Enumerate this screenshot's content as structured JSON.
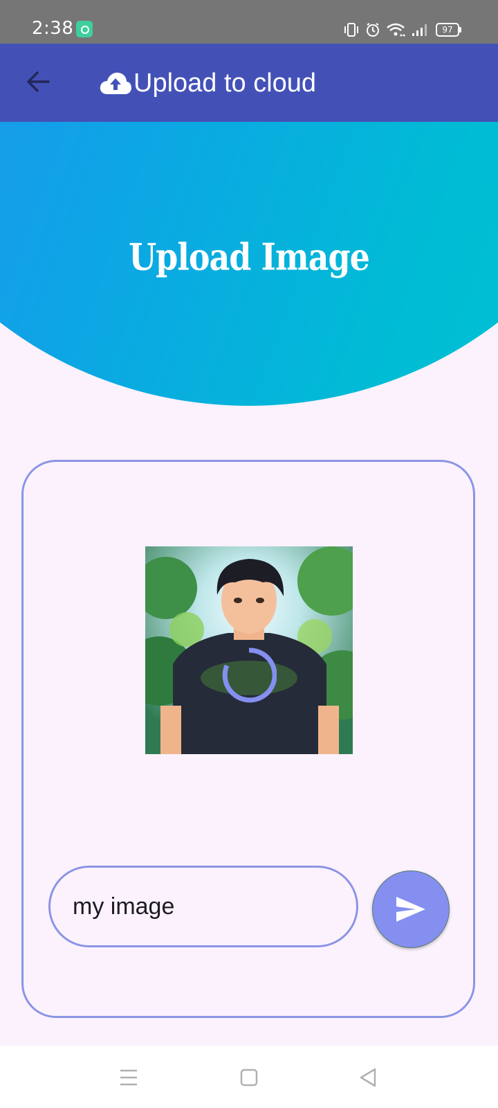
{
  "status_bar": {
    "time": "2:38",
    "battery": "97",
    "icons": [
      "app-icon",
      "vibrate-icon",
      "alarm-icon",
      "wifi-icon",
      "signal-icon",
      "battery-icon"
    ]
  },
  "app_bar": {
    "title": "Upload to cloud",
    "back_icon": "arrow-left-icon",
    "title_icon": "cloud-upload-icon"
  },
  "hero": {
    "title": "Upload Image"
  },
  "upload_card": {
    "image_caption_input": {
      "value": "my image"
    },
    "send_icon": "send-icon",
    "loading_icon": "spinner-icon"
  },
  "nav_bar": {
    "icons": [
      "menu-icon",
      "home-icon",
      "back-icon"
    ]
  },
  "colors": {
    "status_bar": "#767676",
    "app_bar": "#4351b7",
    "accent": "#848ff0",
    "border": "#8b94e6",
    "background": "#fbf2fd",
    "hero_start": "#2c8ef2",
    "hero_end": "#00c3d3"
  }
}
